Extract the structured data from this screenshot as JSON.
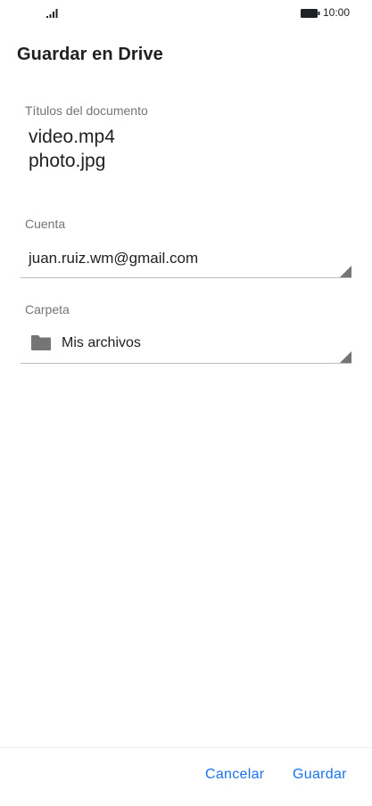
{
  "status_bar": {
    "time": "10:00",
    "signal_icon": "signal-bars-icon",
    "battery_icon": "battery-icon"
  },
  "header": {
    "title": "Guardar en Drive"
  },
  "form": {
    "document_titles_label": "Títulos del documento",
    "document_titles": [
      "video.mp4",
      "photo.jpg"
    ],
    "account_label": "Cuenta",
    "account_value": "juan.ruiz.wm@gmail.com",
    "folder_label": "Carpeta",
    "folder_value": "Mis archivos",
    "folder_icon": "folder-icon"
  },
  "actions": {
    "cancel_label": "Cancelar",
    "save_label": "Guardar"
  },
  "colors": {
    "accent": "#1a73e8",
    "text_primary": "#202124",
    "text_secondary": "#70757a",
    "icon_gray": "#757575"
  }
}
